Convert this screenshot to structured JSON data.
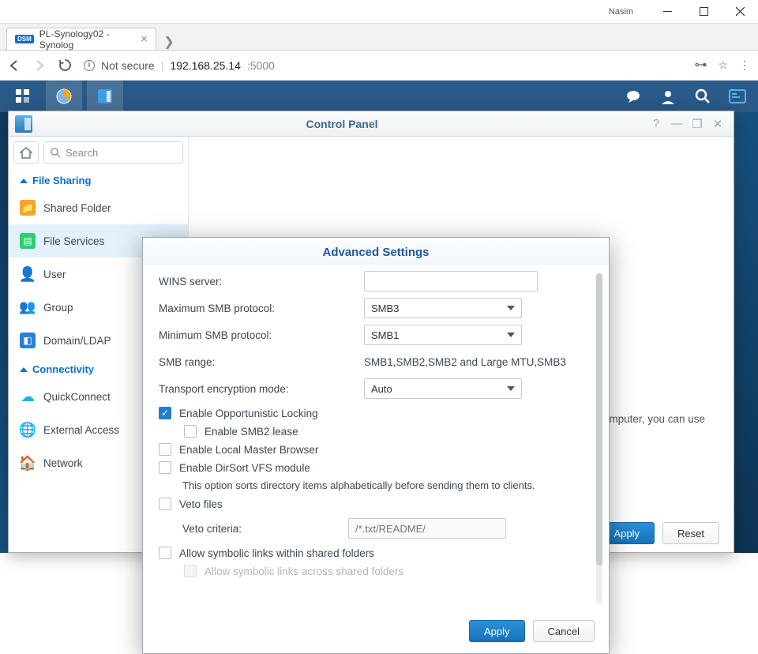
{
  "win": {
    "user": "Nasim"
  },
  "tab": {
    "title": "PL-Synology02 - Synolog"
  },
  "url": {
    "not_secure": "Not secure",
    "ip": "192.168.25.14",
    "port": ":5000"
  },
  "cp": {
    "title": "Control Panel",
    "search_placeholder": "Search",
    "sections": {
      "file_sharing": "File Sharing",
      "connectivity": "Connectivity"
    },
    "nav": {
      "shared_folder": "Shared Folder",
      "file_services": "File Services",
      "user": "User",
      "group": "Group",
      "domain_ldap": "Domain/LDAP",
      "quickconnect": "QuickConnect",
      "external_access": "External Access",
      "network": "Network"
    },
    "hint": "mputer, you can use",
    "footer": {
      "apply": "Apply",
      "reset": "Reset"
    }
  },
  "modal": {
    "title": "Advanced Settings",
    "labels": {
      "wins": "WINS server:",
      "max_smb": "Maximum SMB protocol:",
      "min_smb": "Minimum SMB protocol:",
      "smb_range": "SMB range:",
      "transport": "Transport encryption mode:",
      "veto_criteria": "Veto criteria:"
    },
    "values": {
      "wins": "",
      "max_smb": "SMB3",
      "min_smb": "SMB1",
      "smb_range": "SMB1,SMB2,SMB2 and Large MTU,SMB3",
      "transport": "Auto",
      "veto_placeholder": "/*.txt/README/"
    },
    "checks": {
      "oplock": "Enable Opportunistic Locking",
      "smb2_lease": "Enable SMB2 lease",
      "local_master": "Enable Local Master Browser",
      "dirsort": "Enable DirSort VFS module",
      "dirsort_help": "This option sorts directory items alphabetically before sending them to clients.",
      "veto": "Veto files",
      "symlinks_within": "Allow symbolic links within shared folders",
      "symlinks_across": "Allow symbolic links across shared folders"
    },
    "footer": {
      "apply": "Apply",
      "cancel": "Cancel"
    }
  }
}
